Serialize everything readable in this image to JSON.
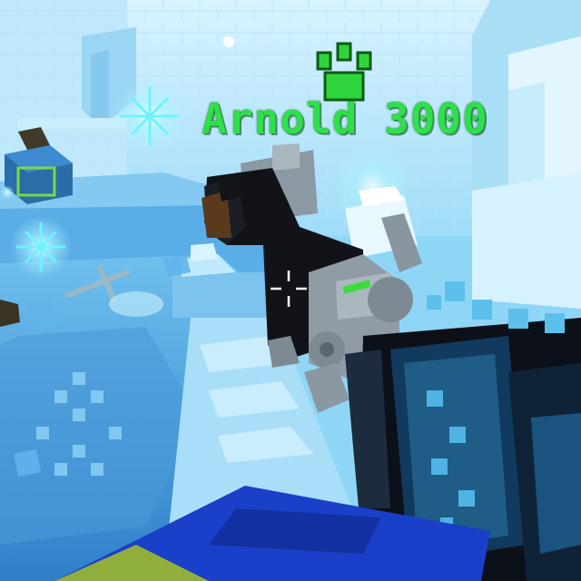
{
  "pet": {
    "name": "Arnold 3000",
    "badge_icon": "paw-icon",
    "badge_color": "#2fd43c"
  },
  "hud": {
    "crosshair_icon": "crosshair-icon"
  },
  "palette": {
    "ice_light": "#cdeefc",
    "ice_mid": "#7fcbf0",
    "ice_deep": "#3a8fcf",
    "sparkle": "#7ff3ff",
    "nameplate_green": "#2ee04a",
    "weapon_blue": "#1a3fc8"
  }
}
